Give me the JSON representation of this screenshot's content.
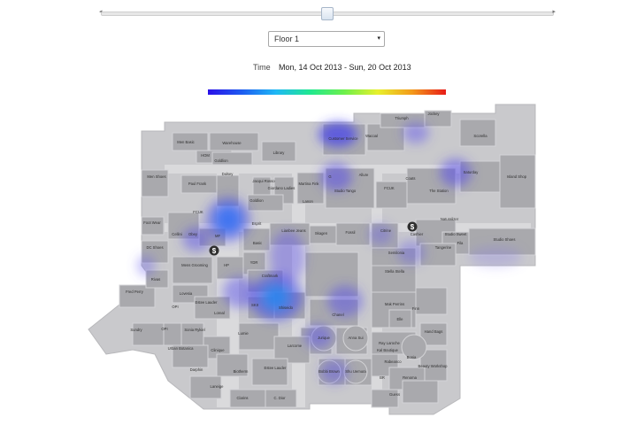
{
  "slider": {
    "left_arrow": "◂",
    "right_arrow": "▸"
  },
  "floor_select": {
    "value": "Floor 1",
    "caret": "▾"
  },
  "time": {
    "label": "Time",
    "value": "Mon, 14 Oct 2013 - Sun, 20 Oct 2013"
  },
  "legend": {
    "colors": [
      "#2a10e8",
      "#1fb8f5",
      "#20e890",
      "#e8f02c",
      "#e81c18"
    ]
  },
  "map": {
    "cashier_symbol": "$",
    "stores": [
      "Men Basic",
      "Warehouse",
      "HOM",
      "Goldlion",
      "Library",
      "Customer Service",
      "Wacoal",
      "Triumph",
      "Jockey",
      "Scorella",
      "Men Shoes",
      "Paul Frank",
      "Dalsey",
      "Jacqui Rosso",
      "Giordano Ladies",
      "Martina Fink",
      "Allure",
      "G",
      "Studio Tango",
      "FCUK",
      "Coats",
      "The Station",
      "Saturday",
      "Island Shop",
      "Goldlion",
      "Lanon",
      "FCUK",
      "Foot Wear",
      "Obey",
      "MF",
      "Cellini",
      "Esprit",
      "Basic",
      "Lianbee Jeans",
      "Skagen",
      "Fossil",
      "Citrine",
      "Cashier",
      "Naturalizer",
      "Studio Sweet",
      "Studio Shoes",
      "DC Shoes",
      "Mens Grooming",
      "HP",
      "YDR",
      "Tangerine",
      "Fila",
      "Semilonia",
      "Stella Stella",
      "Fred Perry",
      "Rivas",
      "Lovesia",
      "Craftmark",
      "Estee Lauder",
      "OPI",
      "Loreal",
      "SKII",
      "Shiseido",
      "Chanel",
      "Mak Perrins",
      "Elle",
      "Finn",
      "Sundry",
      "OPI",
      "Sonia Rykiel",
      "Lumie",
      "Larcome",
      "Jurique",
      "Anna Sui",
      "Ray Laroche",
      "Hand Bags",
      "Urban Botanica",
      "Clinique",
      "Kal Boutique",
      "Bonia",
      "Beauty Workshop",
      "Darphin",
      "Biotherm",
      "Estee Lauder",
      "Bobbi Brown",
      "Shu Uemura",
      "Rabeanco",
      "BR",
      "Renoma",
      "Laneige",
      "Clarins",
      "C. Dior",
      "Guess"
    ]
  }
}
